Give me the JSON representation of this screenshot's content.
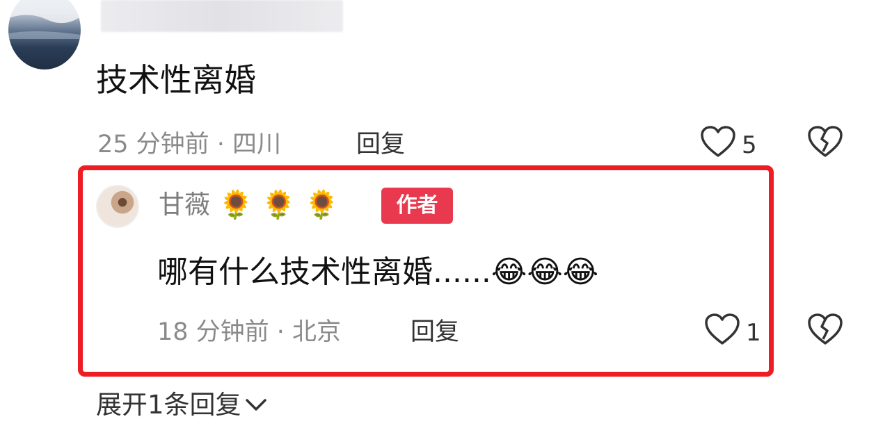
{
  "comment": {
    "text": "技术性离婚",
    "meta": "25 分钟前 · 四川",
    "reply_label": "回复",
    "like_count": "5"
  },
  "reply": {
    "username": "甘薇",
    "flowers": [
      "🌻",
      "🌻",
      "🌻"
    ],
    "author_badge": "作者",
    "text": "哪有什么技术性离婚......",
    "emojis": [
      "😂",
      "😂",
      "😂"
    ],
    "meta": "18 分钟前 · 北京",
    "reply_label": "回复",
    "like_count": "1"
  },
  "expand_label": "展开1条回复",
  "colors": {
    "highlight_border": "#ee1d23",
    "author_badge": "#e8394f",
    "meta_text": "#8a8a8a"
  },
  "icons": [
    "heart-outline-icon",
    "broken-heart-icon",
    "chevron-down-icon"
  ]
}
